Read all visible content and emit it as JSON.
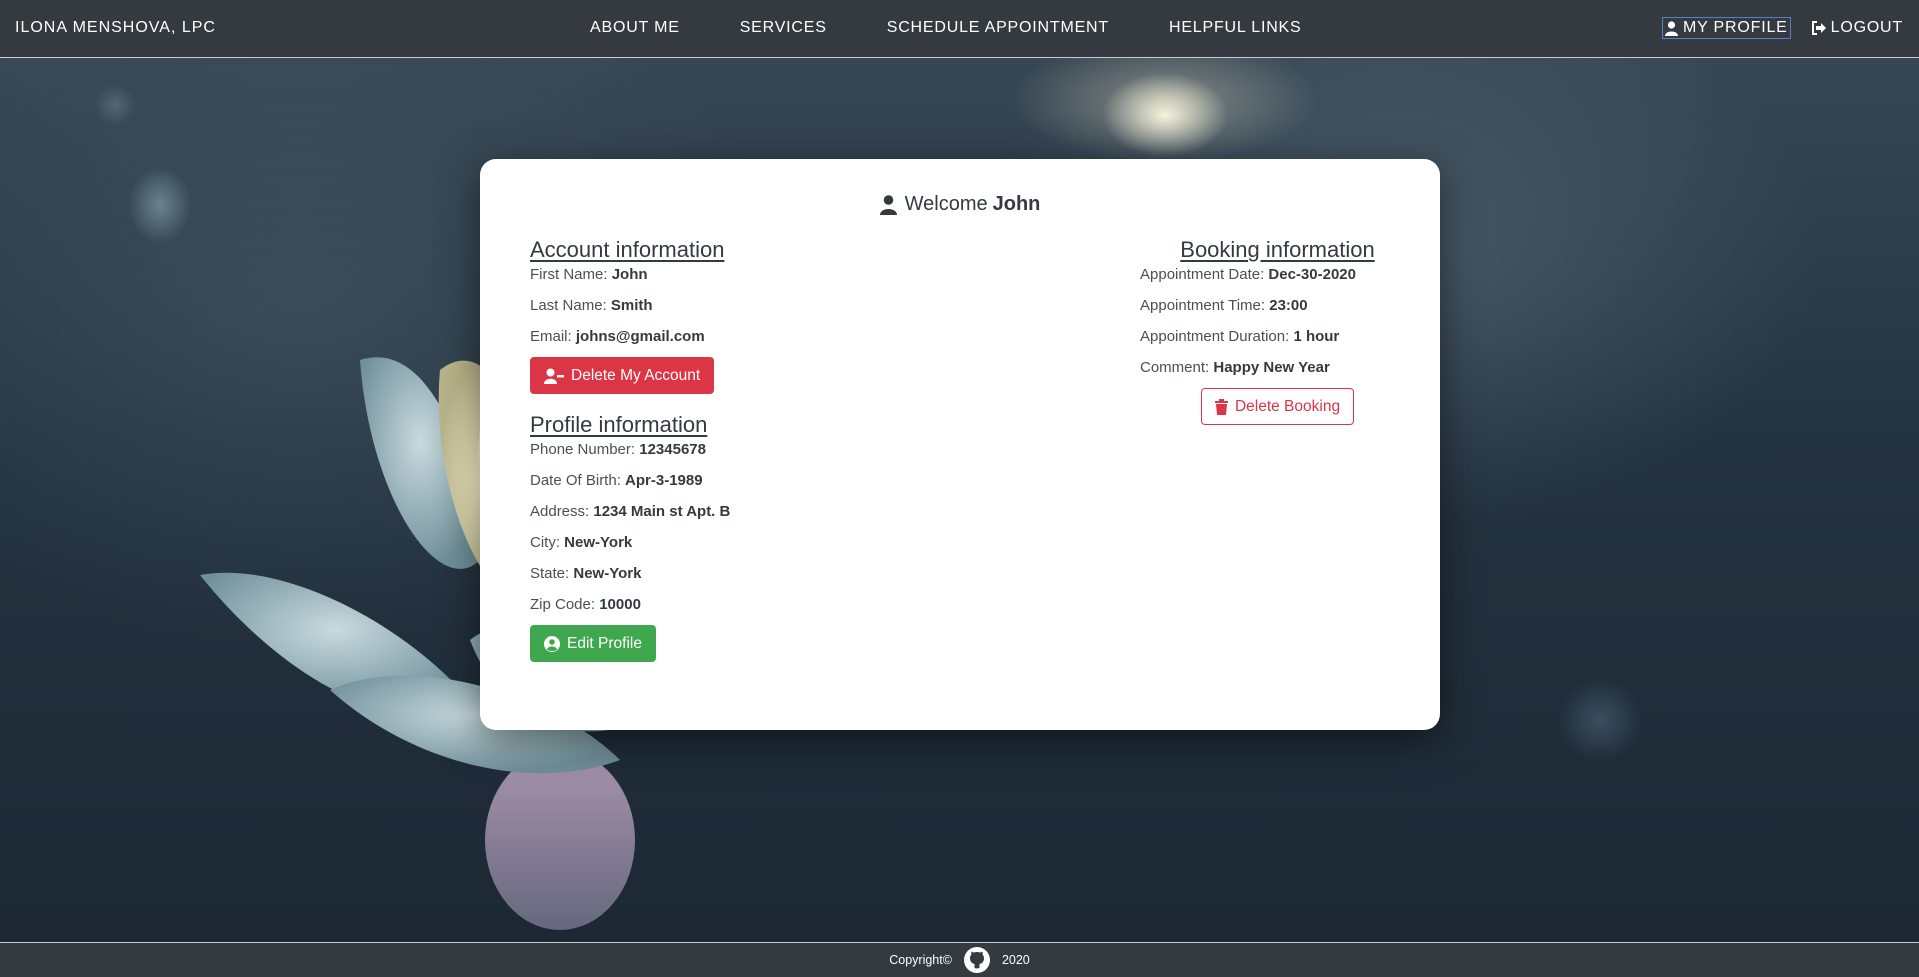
{
  "navbar": {
    "brand": "ILONA MENSHOVA, LPC",
    "links": [
      "ABOUT ME",
      "SERVICES",
      "SCHEDULE APPOINTMENT",
      "HELPFUL LINKS"
    ],
    "my_profile": "MY PROFILE",
    "logout": "LOGOUT"
  },
  "welcome": {
    "prefix": "Welcome",
    "name": "John"
  },
  "account": {
    "title": "Account information",
    "first_name_label": "First Name:",
    "first_name": "John",
    "last_name_label": "Last Name:",
    "last_name": "Smith",
    "email_label": "Email:",
    "email": "johns@gmail.com",
    "delete_button": "Delete My Account"
  },
  "profile": {
    "title": "Profile information",
    "phone_label": "Phone Number:",
    "phone": "12345678",
    "dob_label": "Date Of Birth:",
    "dob": "Apr-3-1989",
    "address_label": "Address:",
    "address": "1234 Main st Apt. B",
    "city_label": "City:",
    "city": "New-York",
    "state_label": "State:",
    "state": "New-York",
    "zip_label": "Zip Code:",
    "zip": "10000",
    "edit_button": "Edit Profile"
  },
  "booking": {
    "title": "Booking information",
    "date_label": "Appointment Date:",
    "date": "Dec-30-2020",
    "time_label": "Appointment Time:",
    "time": "23:00",
    "duration_label": "Appointment Duration:",
    "duration": "1 hour",
    "comment_label": "Comment:",
    "comment": "Happy New Year",
    "delete_button": "Delete Booking"
  },
  "footer": {
    "copyright": "Copyright©",
    "year": "2020"
  },
  "colors": {
    "navbar": "#343a40",
    "danger": "#dc3545",
    "success": "#3fa84e",
    "active_border": "#5b7dc6"
  },
  "icons": [
    "user-icon",
    "sign-out-icon",
    "user-minus-icon",
    "user-circle-icon",
    "trash-icon",
    "github-icon"
  ]
}
